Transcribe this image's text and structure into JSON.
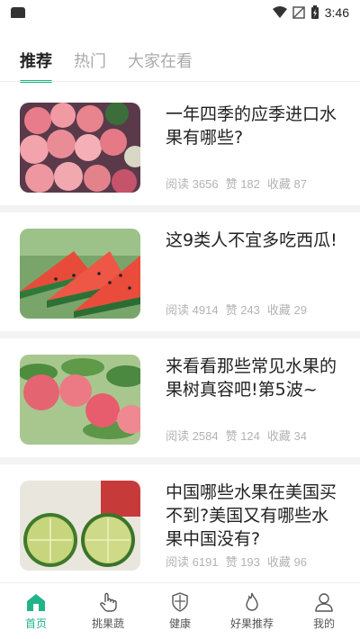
{
  "status": {
    "time": "3:46"
  },
  "tabs": [
    {
      "label": "推荐",
      "active": true
    },
    {
      "label": "热门",
      "active": false
    },
    {
      "label": "大家在看",
      "active": false
    }
  ],
  "articles": [
    {
      "title": "一年四季的应季进口水果有哪些?",
      "read_label": "阅读",
      "read": "3656",
      "like_label": "赞",
      "like": "182",
      "fav_label": "收藏",
      "fav": "87"
    },
    {
      "title": "这9类人不宜多吃西瓜!",
      "read_label": "阅读",
      "read": "4914",
      "like_label": "赞",
      "like": "243",
      "fav_label": "收藏",
      "fav": "29"
    },
    {
      "title": "来看看那些常见水果的果树真容吧!第5波~",
      "read_label": "阅读",
      "read": "2584",
      "like_label": "赞",
      "like": "124",
      "fav_label": "收藏",
      "fav": "34"
    },
    {
      "title": "中国哪些水果在美国买不到?美国又有哪些水果中国没有?",
      "read_label": "阅读",
      "read": "6191",
      "like_label": "赞",
      "like": "193",
      "fav_label": "收藏",
      "fav": "96"
    }
  ],
  "nav": [
    {
      "label": "首页",
      "icon": "home-icon",
      "active": true
    },
    {
      "label": "挑果蔬",
      "icon": "hand-pointer-icon",
      "active": false
    },
    {
      "label": "健康",
      "icon": "shield-icon",
      "active": false
    },
    {
      "label": "好果推荐",
      "icon": "flame-icon",
      "active": false
    },
    {
      "label": "我的",
      "icon": "user-icon",
      "active": false
    }
  ],
  "colors": {
    "accent": "#21b38a"
  }
}
